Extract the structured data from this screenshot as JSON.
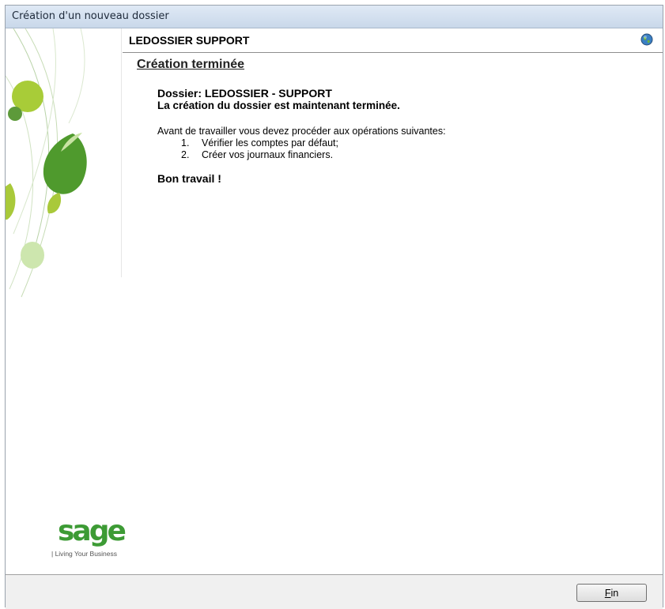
{
  "window": {
    "title": "Création d'un nouveau dossier"
  },
  "header": {
    "company": "LEDOSSIER SUPPORT",
    "icon": "globe-icon"
  },
  "main": {
    "title": "Création terminée",
    "dossier_line": "Dossier: LEDOSSIER - SUPPORT",
    "done_line": "La création du dossier est maintenant terminée.",
    "intro": "Avant de travailler vous devez procéder aux opérations suivantes:",
    "steps": [
      {
        "num": "1.",
        "text": "Vérifier les comptes par défaut;"
      },
      {
        "num": "2.",
        "text": "Créer vos journaux financiers."
      }
    ],
    "closing": "Bon travail !"
  },
  "logo": {
    "name": "sage",
    "tagline": "| Living Your Business"
  },
  "footer": {
    "fin_accel": "F",
    "fin_rest": "in"
  },
  "colors": {
    "brand_green": "#3d9b35",
    "leaf_light": "#b9d86a",
    "leaf_dark": "#4f9a2d"
  }
}
